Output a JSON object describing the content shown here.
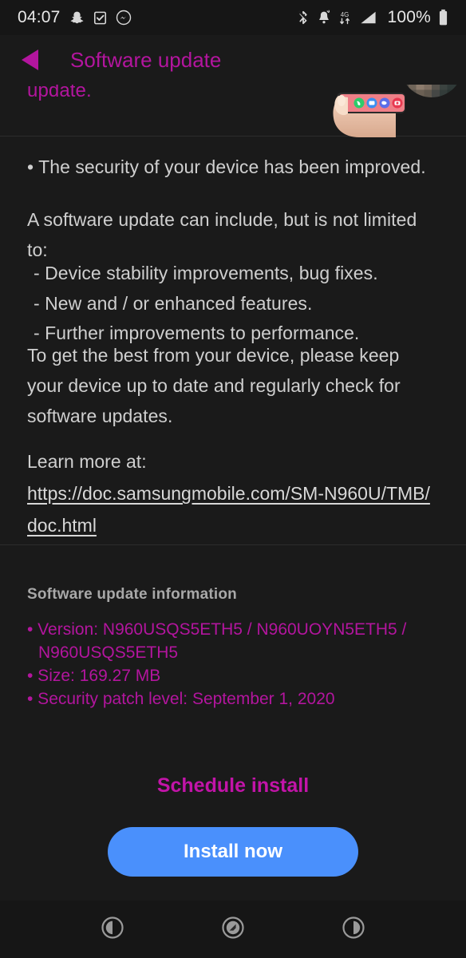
{
  "status_bar": {
    "clock": "04:07",
    "battery_percent": "100%",
    "left_icons": [
      "snapchat-icon",
      "checkbox-icon",
      "messenger-icon"
    ],
    "right_icons": [
      "bluetooth-disconnected-icon",
      "notification-bell-icon",
      "data-transfer-icon",
      "signal-strength-icon",
      "battery-icon"
    ]
  },
  "header": {
    "back_icon": "back-triangle-icon",
    "title": "Software update",
    "avatar": "pixelated-avatar"
  },
  "content": {
    "cut_off_line": "update.",
    "hero_image": "hand-holding-phone-image",
    "paragraph_1": "• The security of your device has been improved.",
    "paragraph_2_intro": "A software update can include, but is not limited to:",
    "bullet_1": "- Device stability improvements, bug fixes.",
    "bullet_2": "- New and / or enhanced features.",
    "bullet_3": "- Further improvements to performance.",
    "paragraph_3": "To get the best from your device, please keep your device up to date and regularly check for software updates.",
    "learn_more_label": "Learn more at:",
    "learn_more_url": "https://doc.samsungmobile.com/SM-N960U/TMB/doc.html"
  },
  "update_info": {
    "heading": "Software update information",
    "version_line_1": "• Version: N960USQS5ETH5 / N960UOYN5ETH5 /",
    "version_line_2": "N960USQS5ETH5",
    "size_line": "• Size: 169.27 MB",
    "security_patch_line": "• Security patch level: September 1, 2020"
  },
  "actions": {
    "schedule_label": "Schedule install",
    "install_label": "Install now"
  },
  "nav_bar": {
    "recents_icon": "recents-circle-icon",
    "home_icon": "home-circle-icon",
    "back_icon": "back-circle-icon"
  },
  "colors": {
    "accent_magenta": "#b3159e",
    "install_blue": "#4a90fc",
    "background": "#1a1a1a",
    "body_text": "#cfcfcf"
  }
}
